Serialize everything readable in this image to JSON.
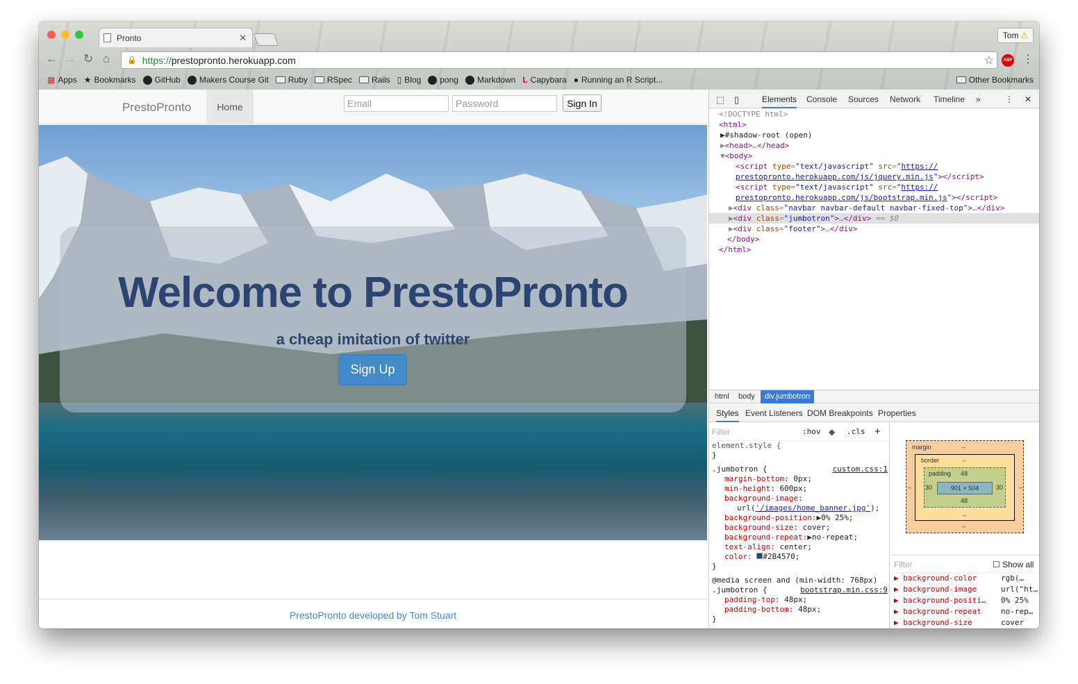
{
  "browser": {
    "tab_title": "Pronto",
    "profile_name": "Tom",
    "url_scheme": "https://",
    "url_host": "prestopronto.herokuapp.com",
    "abp_label": "ABP",
    "bookmarks": [
      "Apps",
      "Bookmarks",
      "GitHub",
      "Makers Course Git",
      "Ruby",
      "RSpec",
      "Rails",
      "Blog",
      "pong",
      "Markdown",
      "Capybara",
      "Running an R Script..."
    ],
    "other_bookmarks": "Other Bookmarks"
  },
  "site": {
    "brand": "PrestoPronto",
    "nav_home": "Home",
    "email_placeholder": "Email",
    "password_placeholder": "Password",
    "signin_label": "Sign In",
    "headline": "Welcome to PrestoPronto",
    "subheadline": "a cheap imitation of twitter",
    "signup_label": "Sign Up",
    "footer": "PrestoPronto developed by Tom Stuart",
    "text_color": "#2b4570",
    "button_color": "#428bca"
  },
  "devtools": {
    "tabs": [
      "Elements",
      "Console",
      "Sources",
      "Network",
      "Timeline"
    ],
    "more": "»",
    "breadcrumbs": [
      "html",
      "body",
      "div.jumbotron"
    ],
    "style_tabs": [
      "Styles",
      "Event Listeners",
      "DOM Breakpoints",
      "Properties"
    ],
    "filter": "Filter",
    "hov": ":hov",
    "cls": ".cls",
    "plus": "+",
    "box_model": {
      "margin_label": "margin",
      "margin_value": "–",
      "border_label": "border",
      "border_value": "–",
      "padding_label": "padding",
      "padding_top": "48",
      "padding_bottom": "48",
      "padding_left": "30",
      "padding_right": "30",
      "content": "901 × 504",
      "bottom_margin": "–",
      "bottom_border": "–",
      "side_margin": "–"
    },
    "show_all": "Show all",
    "computed": [
      {
        "name": "background-color",
        "value": "rgb(…"
      },
      {
        "name": "background-image",
        "value": "url(\"ht…"
      },
      {
        "name": "background-positi…",
        "value": "0% 25%"
      },
      {
        "name": "background-repeat",
        "value": "no-rep…"
      },
      {
        "name": "background-size",
        "value": "cover"
      }
    ]
  }
}
